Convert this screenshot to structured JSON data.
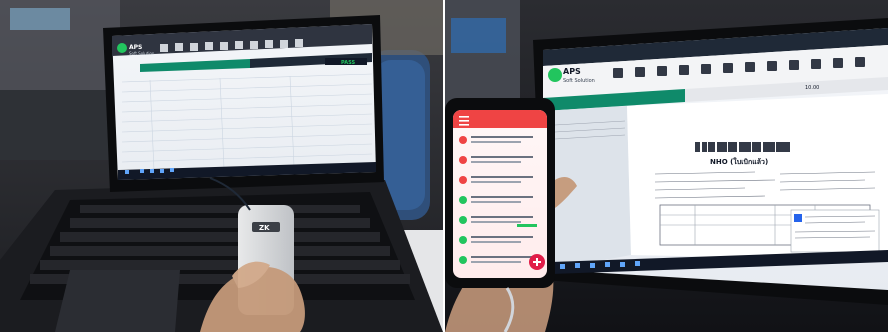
{
  "left_photo": {
    "laptop_app": {
      "logo": "APS",
      "brand_line": "Soft Solution",
      "status_text": "PASS"
    },
    "scanner_logo": "ZK"
  },
  "right_photo": {
    "laptop_app": {
      "logo": "APS",
      "brand_line": "Soft Solution",
      "document_title": "NHO (ใบเบิกแล้ว)",
      "doc_time": "10.00"
    }
  },
  "colors": {
    "app_green": "#0f8a6a",
    "pass_green": "#22c55e",
    "phone_header_red": "#ef4444",
    "phone_fab_red": "#e11d48"
  }
}
